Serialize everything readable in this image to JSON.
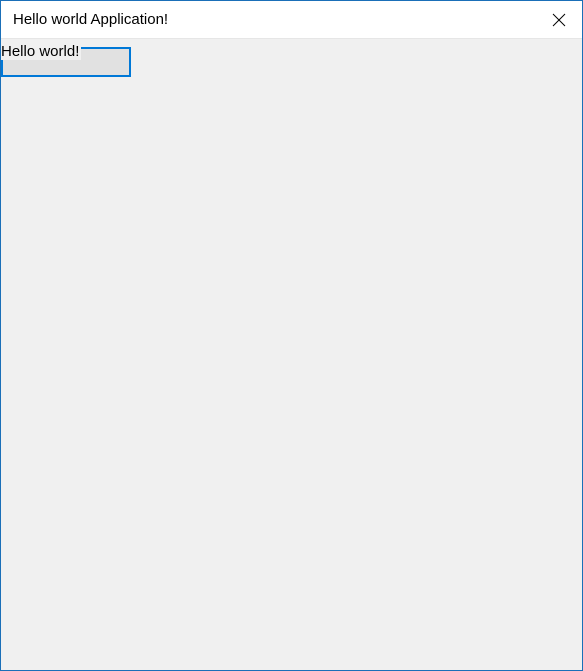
{
  "window": {
    "title": "Hello world Application!"
  },
  "main": {
    "label_text": "Hello world!",
    "button_text": ""
  }
}
